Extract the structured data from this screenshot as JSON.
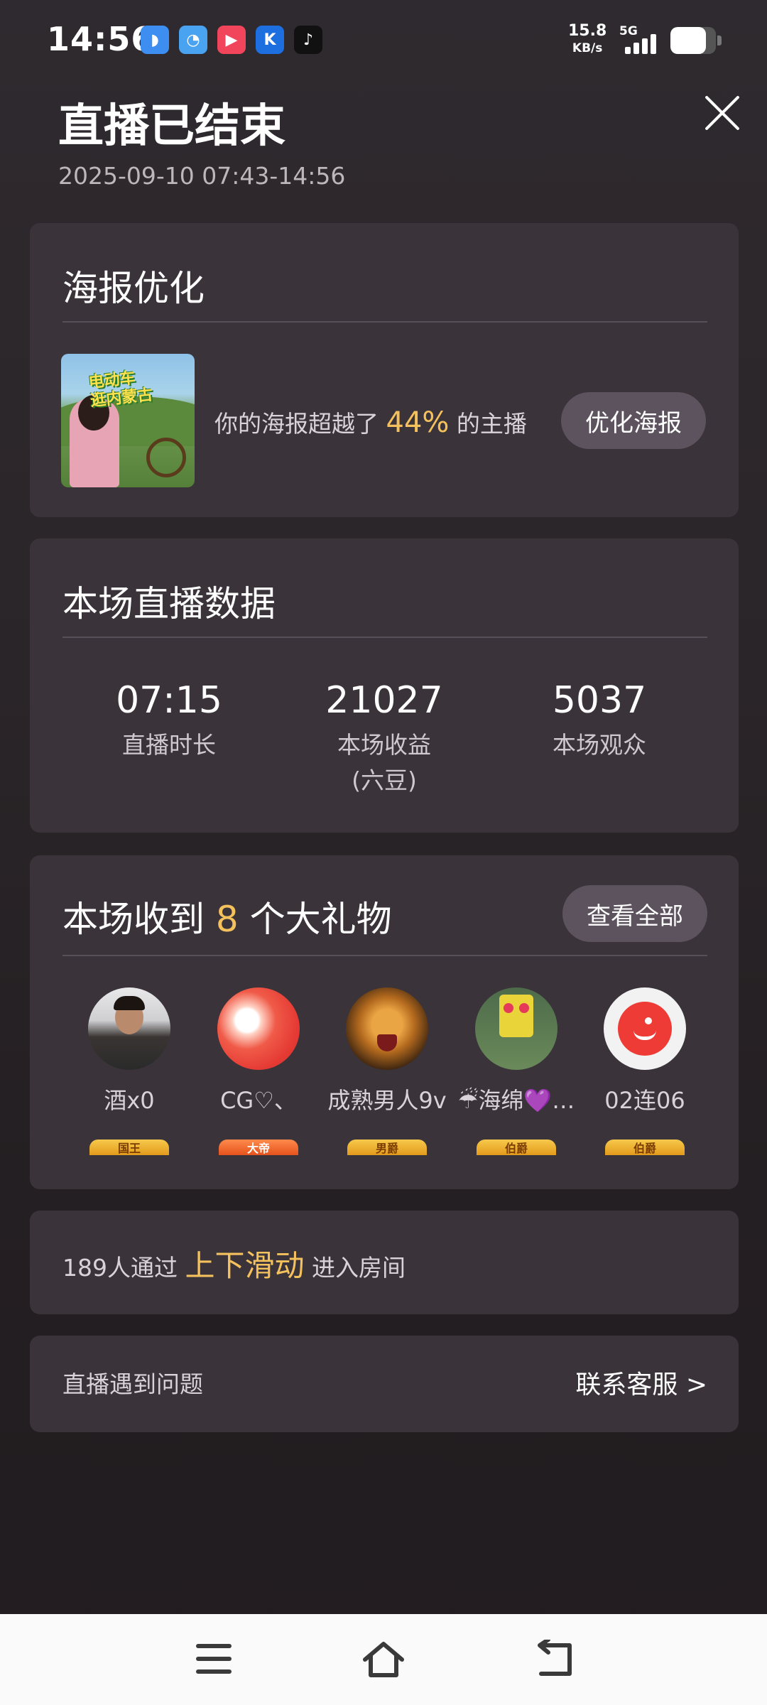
{
  "status_bar": {
    "time": "14:56",
    "notification_icons": [
      {
        "name": "browser-app-icon",
        "color": "#3d8ef0",
        "glyph": "◗"
      },
      {
        "name": "files-app-icon",
        "color": "#4aa3f0",
        "glyph": "◔"
      },
      {
        "name": "video-app-icon",
        "color": "#f0455b",
        "glyph": "▶"
      },
      {
        "name": "kugou-app-icon",
        "color": "#1d6fe0",
        "glyph": "K"
      },
      {
        "name": "tiktok-app-icon",
        "color": "#111111",
        "glyph": "♪"
      }
    ],
    "net_speed": "15.8",
    "net_unit": "KB/s",
    "network_type": "5G",
    "signal_level": 1.0,
    "battery_level": 0.78
  },
  "header": {
    "title": "直播已结束",
    "time_range": "2025-09-10 07:43-14:56"
  },
  "poster": {
    "title": "海报优化",
    "thumb_text_line1": "电动车",
    "thumb_text_line2": "逛内蒙古",
    "text_before": "你的海报超越了",
    "percent": "44%",
    "text_after": "的主播",
    "button_label": "优化海报"
  },
  "stats": {
    "title": "本场直播数据",
    "items": [
      {
        "value": "07:15",
        "label": "直播时长",
        "label2": ""
      },
      {
        "value": "21027",
        "label": "本场收益",
        "label2": "(六豆)"
      },
      {
        "value": "5037",
        "label": "本场观众",
        "label2": ""
      }
    ]
  },
  "gifts": {
    "title_before": "本场收到",
    "count": "8",
    "title_after": "个大礼物",
    "view_all_label": "查看全部",
    "users": [
      {
        "name": "酒x0",
        "badge": "国王"
      },
      {
        "name": "CG♡、",
        "badge": "大帝"
      },
      {
        "name": "成熟男人9v",
        "badge": "男爵"
      },
      {
        "name": "☔海绵💜…",
        "badge": "伯爵"
      },
      {
        "name": "02连06",
        "badge": "伯爵"
      }
    ]
  },
  "swipe": {
    "text_before": "189人通过",
    "highlight": "上下滑动",
    "text_after": "进入房间"
  },
  "help": {
    "text": "直播遇到问题",
    "link": "联系客服 >"
  },
  "colors": {
    "accent": "#f4c15c",
    "card_bg": "#3a333a",
    "page_bg": "#2a2528"
  }
}
